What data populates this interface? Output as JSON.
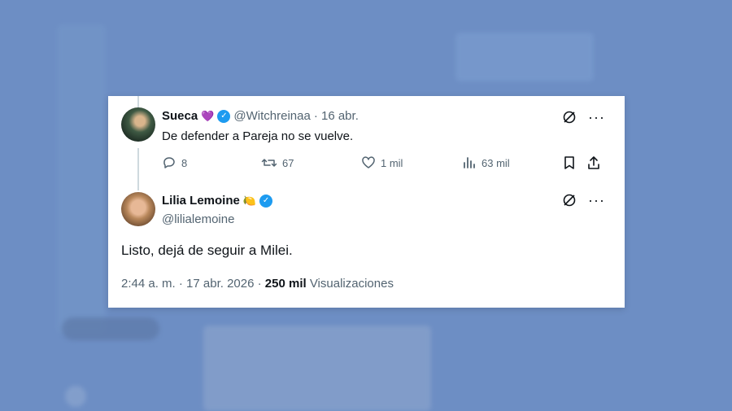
{
  "reply": {
    "name": "Sueca",
    "emoji": "💜",
    "handle": "@Witchreinaa",
    "date": "· 16 abr.",
    "text": "De defender a Pareja no se vuelve.",
    "verified": true,
    "actions": {
      "replies": "8",
      "reposts": "67",
      "likes": "1 mil",
      "views": "63 mil"
    }
  },
  "main": {
    "name": "Lilia Lemoine",
    "emoji": "🍋",
    "handle": "@lilialemoine",
    "verified": true,
    "text": "Listo, dejá de seguir a Milei.",
    "time": "2:44 a. m. · 17 abr. 2026 ·",
    "views_count": "250 mil",
    "views_label": "Visualizaciones"
  },
  "colors": {
    "verified": "#1d9bf0",
    "secondary_text": "#536471",
    "background": "#6d8ec4"
  },
  "icons": [
    "grok-icon",
    "more-icon",
    "reply-icon",
    "repost-icon",
    "like-icon",
    "views-icon",
    "bookmark-icon",
    "share-icon"
  ]
}
